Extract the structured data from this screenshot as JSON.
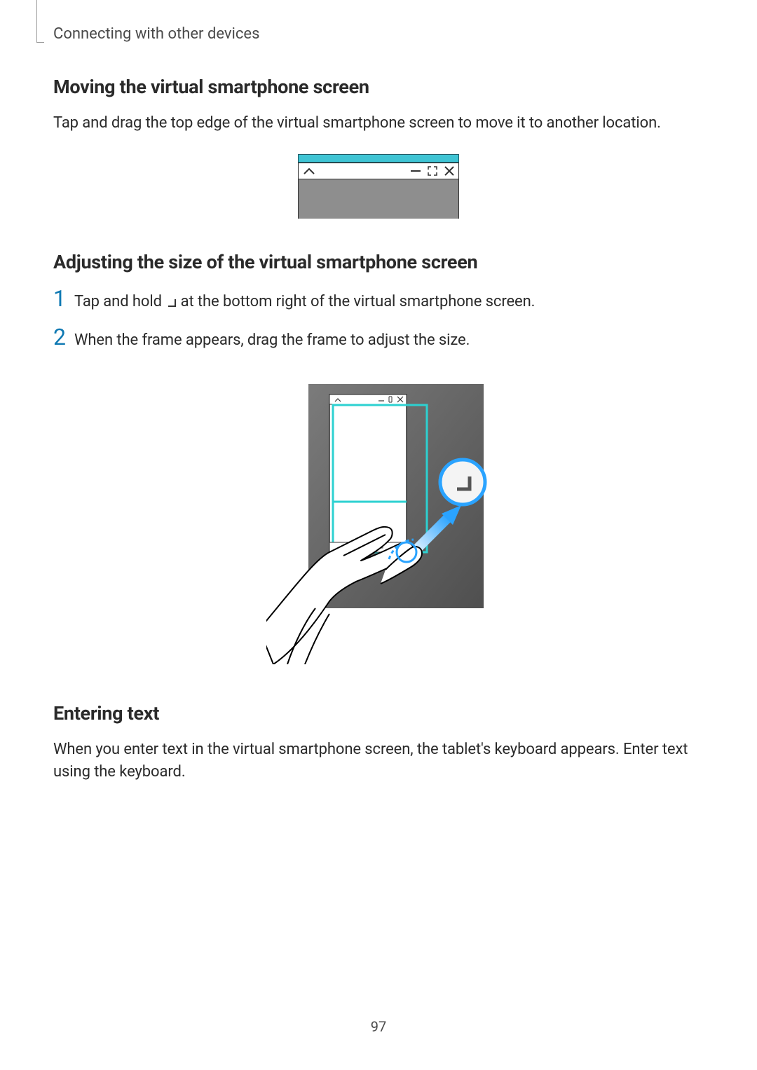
{
  "breadcrumb": "Connecting with other devices",
  "sections": {
    "moving": {
      "heading": "Moving the virtual smartphone screen",
      "body": "Tap and drag the top edge of the virtual smartphone screen to move it to another location."
    },
    "adjusting": {
      "heading": "Adjusting the size of the virtual smartphone screen",
      "steps": [
        {
          "num": "1",
          "pre": "Tap and hold ",
          "post": " at the bottom right of the virtual smartphone screen."
        },
        {
          "num": "2",
          "pre": "When the frame appears, drag the frame to adjust the size.",
          "post": ""
        }
      ]
    },
    "entering": {
      "heading": "Entering text",
      "body": "When you enter text in the virtual smartphone screen, the tablet's keyboard appears. Enter text using the keyboard."
    }
  },
  "page_number": "97"
}
